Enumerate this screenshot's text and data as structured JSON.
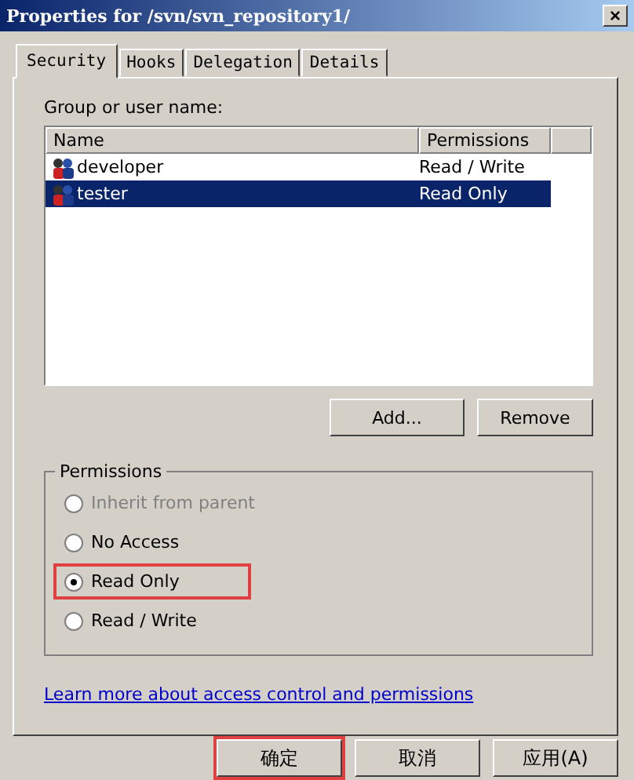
{
  "window": {
    "title": "Properties for /svn/svn_repository1/",
    "close": "×"
  },
  "tabs": [
    {
      "label": "Security",
      "selected": true
    },
    {
      "label": "Hooks",
      "selected": false
    },
    {
      "label": "Delegation",
      "selected": false
    },
    {
      "label": "Details",
      "selected": false
    }
  ],
  "group_label": "Group or user name:",
  "table": {
    "columns": [
      "Name",
      "Permissions"
    ],
    "rows": [
      {
        "name": "developer",
        "permissions": "Read / Write",
        "selected": false
      },
      {
        "name": "tester",
        "permissions": "Read Only",
        "selected": true
      }
    ]
  },
  "list_buttons": [
    "Add...",
    "Remove"
  ],
  "permissions": {
    "title": "Permissions",
    "options": [
      {
        "label": "Inherit from parent",
        "selected": false,
        "disabled": true,
        "highlighted": false
      },
      {
        "label": "No Access",
        "selected": false,
        "disabled": false,
        "highlighted": false
      },
      {
        "label": "Read Only",
        "selected": true,
        "disabled": false,
        "highlighted": true
      },
      {
        "label": "Read / Write",
        "selected": false,
        "disabled": false,
        "highlighted": false
      }
    ]
  },
  "link": "Learn more about access control and permissions",
  "buttons": [
    {
      "label": "确定",
      "highlighted": true
    },
    {
      "label": "取消",
      "highlighted": false
    },
    {
      "label": "应用(A)",
      "highlighted": false
    }
  ]
}
